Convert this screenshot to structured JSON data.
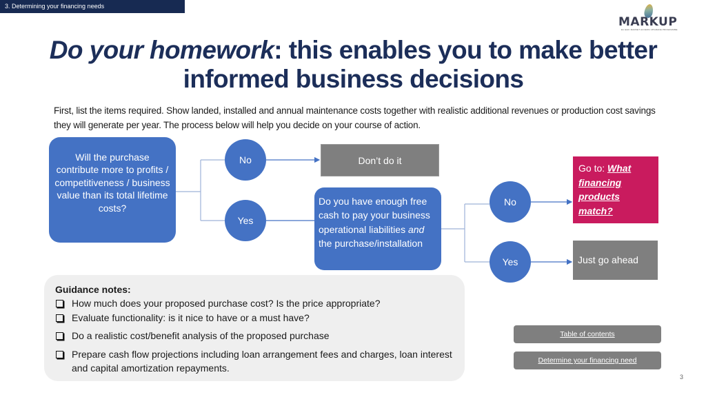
{
  "section_tag": "3. Determining your financing needs",
  "logo": {
    "name": "MARKUP",
    "subtitle": "EU-EAC MARKET ACCESS UPGRADE PROGRAMME"
  },
  "title": {
    "italic_part": "Do your homework",
    "rest": ": this enables you to make better informed business decisions"
  },
  "intro": "First, list the items required. Show landed, installed and annual maintenance costs together with realistic additional revenues or production cost savings they will generate per year. The process below will help you decide on your course of action.",
  "flow": {
    "question1": "Will the purchase contribute more to profits / competitiveness / business value than its total lifetime costs?",
    "no1": "No",
    "yes1": "Yes",
    "dont": "Don’t do it",
    "question2": {
      "before": "Do you have enough free cash to pay your business operational liabilities ",
      "italic": "and",
      "after": " the purchase/installation"
    },
    "no2": "No",
    "yes2": "Yes",
    "goto": {
      "prefix": "Go to: ",
      "link": "What financing products match?"
    },
    "ahead": "Just go ahead"
  },
  "colors": {
    "blue": "#4472c4",
    "gray": "#7f7f7f",
    "magenta": "#c91b5e",
    "navy": "#172a52",
    "title": "#1c2e59"
  },
  "guidance": {
    "heading": "Guidance notes:",
    "items": [
      "How much does your proposed purchase cost? Is the price appropriate?",
      "Evaluate functionality: is it nice to have or a must have?",
      "Do a realistic cost/benefit analysis of the proposed purchase",
      "Prepare cash flow projections including loan arrangement fees and charges, loan interest and capital amortization repayments."
    ]
  },
  "nav": {
    "toc": "Table of contents",
    "need": "Determine your financing need"
  },
  "page_number": "3"
}
